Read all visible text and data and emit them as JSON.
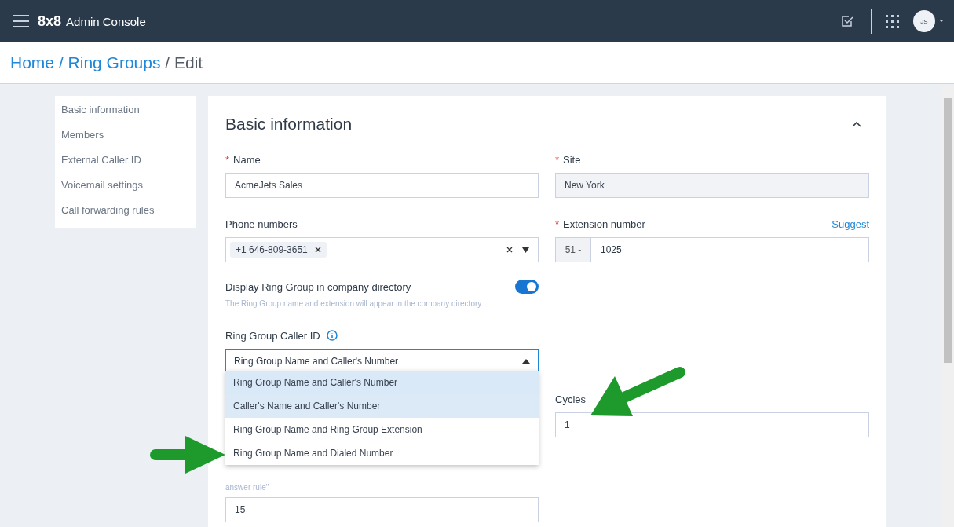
{
  "header": {
    "logo": "8x8",
    "title": "Admin Console",
    "avatar": "JS"
  },
  "breadcrumb": [
    {
      "label": "Home",
      "link": true
    },
    {
      "sep": "/",
      "label": "Ring Groups",
      "link": true
    },
    {
      "sep": "/",
      "label": "Edit",
      "link": false
    }
  ],
  "nav": [
    {
      "label": "Basic information"
    },
    {
      "label": "Members"
    },
    {
      "label": "External Caller ID"
    },
    {
      "label": "Voicemail settings"
    },
    {
      "label": "Call forwarding rules"
    }
  ],
  "section": {
    "title": "Basic information",
    "expanded": true
  },
  "name": {
    "mark": "*",
    "label": "Name",
    "value": "AcmeJets Sales"
  },
  "site": {
    "mark": "*",
    "label": "Site",
    "value": "New York",
    "disabled": true
  },
  "phone_numbers": {
    "label": "Phone numbers",
    "chips": [
      "+1 646-809-3651"
    ]
  },
  "extension": {
    "mark": "*",
    "label": "Extension number",
    "link": "Suggest",
    "prefix": "51 -",
    "value": "1025"
  },
  "directory": {
    "label": "Display Ring Group in company directory",
    "on": true,
    "hint": "The Ring Group name and extension will appear in the company directory"
  },
  "caller_id": {
    "label": "Ring Group Caller ID",
    "value": "Ring Group Name and Caller's Number",
    "expanded": true,
    "options": [
      {
        "label": "Ring Group Name and Caller's Number",
        "selected": true,
        "hovered": false
      },
      {
        "label": "Caller's Name and Caller's Number",
        "selected": false,
        "hovered": true
      },
      {
        "label": "Ring Group Name and Ring Group Extension",
        "selected": false,
        "hovered": false
      },
      {
        "label": "Ring Group Name and Dialed Number",
        "selected": false,
        "hovered": false
      }
    ]
  },
  "ring_time": {
    "hint": "answer rule\"",
    "value": "15"
  },
  "cycles": {
    "label": "Cycles",
    "value": "1"
  }
}
